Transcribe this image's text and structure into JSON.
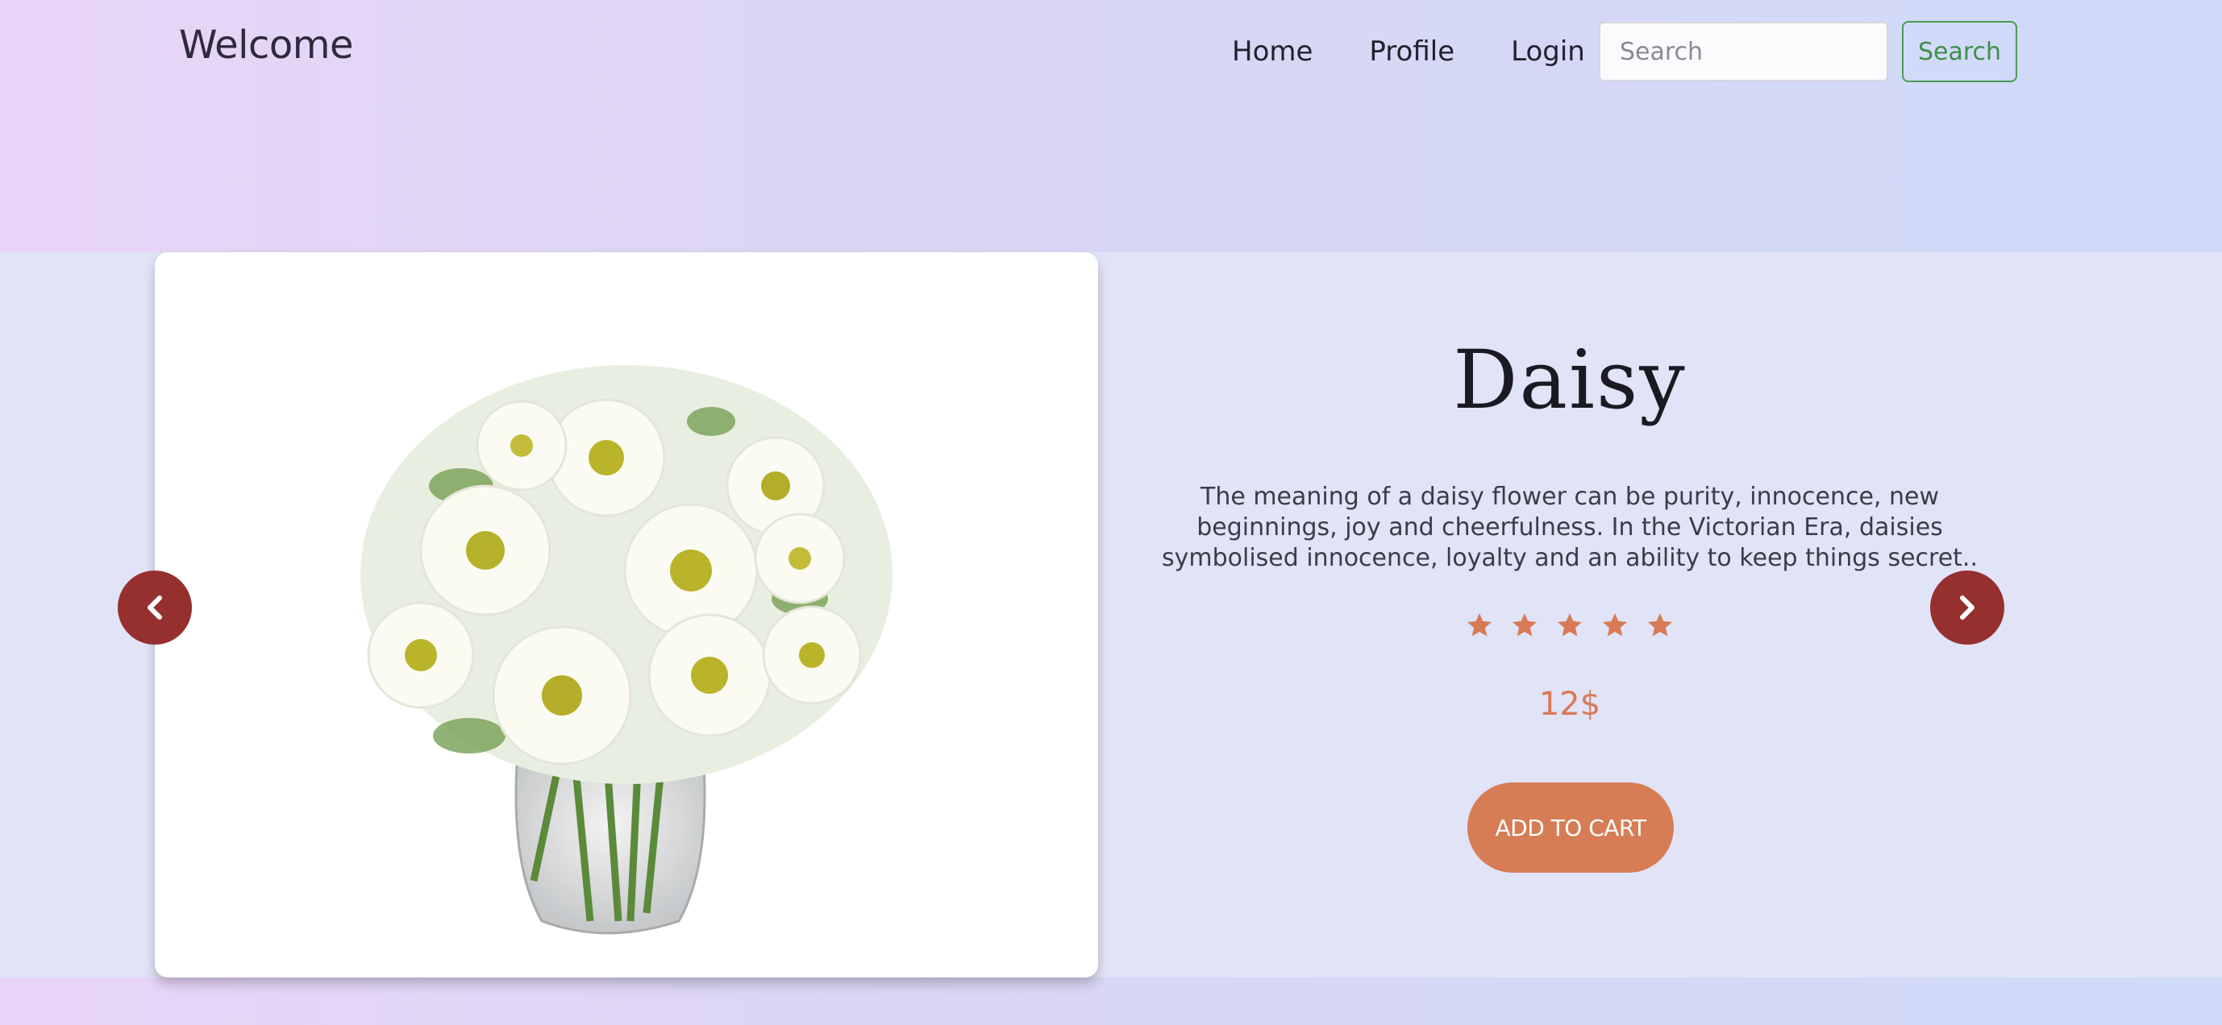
{
  "navbar": {
    "brand": "Welcome",
    "links": [
      "Home",
      "Profile",
      "Login"
    ],
    "search_placeholder": "Search",
    "search_button": "Search"
  },
  "carousel": {
    "prev_icon": "chevron-left-icon",
    "next_icon": "chevron-right-icon"
  },
  "product": {
    "name": "Daisy",
    "description": "The meaning of a daisy flower can be purity, innocence, new beginnings, joy and cheerfulness. In the Victorian Era, daisies symbolised innocence, loyalty and an ability to keep things secret..",
    "rating": 5,
    "rating_max": 5,
    "price": "12$",
    "add_to_cart": "ADD TO CART"
  },
  "colors": {
    "accent": "#d67d56",
    "arrow": "#96302f",
    "search_green": "#4a9a52",
    "star": "#d77a55"
  }
}
